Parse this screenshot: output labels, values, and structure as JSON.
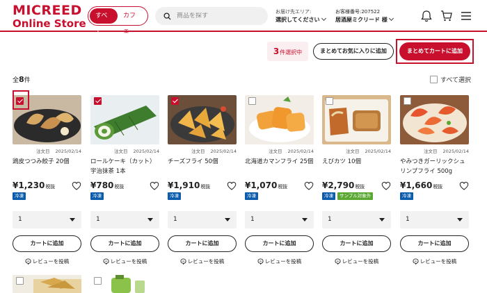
{
  "brand": {
    "line1": "MICREED",
    "line2": "Online Store",
    "color": "#c8102e"
  },
  "header": {
    "toggle": [
      "すべて",
      "カフェ"
    ],
    "search_placeholder": "商品を探す",
    "delivery_label": "お届け先エリア:",
    "delivery_value": "選択してください",
    "customer_label": "お客様番号:207522",
    "customer_value": "居酒屋ミクリード 様",
    "icons": [
      "bell-icon",
      "cart-icon",
      "menu-icon"
    ]
  },
  "actions": {
    "selected_count": "3",
    "selected_suffix": "件選択中",
    "favorite_label": "まとめてお気に入りに追加",
    "cart_label": "まとめてカートに追加"
  },
  "list": {
    "total_prefix": "全",
    "total_count": "8",
    "total_suffix": "件",
    "select_all": "すべて選択"
  },
  "products": [
    {
      "checked": true,
      "order_label": "注文日",
      "date": "2025/02/14",
      "name": "鶏皮つつみ餃子 20個",
      "price": "¥1,230",
      "tax": "税抜",
      "badges": [
        "冷凍"
      ],
      "qty": "1",
      "cart": "カートに追加",
      "review": "レビューを投稿"
    },
    {
      "checked": true,
      "order_label": "注文日",
      "date": "2025/02/14",
      "name": "ロールケーキ（カット）宇治抹茶 1本",
      "price": "¥780",
      "tax": "税抜",
      "badges": [
        "冷凍"
      ],
      "qty": "1",
      "cart": "カートに追加",
      "review": "レビューを投稿"
    },
    {
      "checked": true,
      "order_label": "注文日",
      "date": "2025/02/14",
      "name": "チーズフライ 50個",
      "price": "¥1,910",
      "tax": "税抜",
      "badges": [
        "冷凍"
      ],
      "qty": "1",
      "cart": "カートに追加",
      "review": "レビューを投稿"
    },
    {
      "checked": false,
      "order_label": "注文日",
      "date": "2025/02/14",
      "name": "北海道カマンフライ 25個",
      "price": "¥1,070",
      "tax": "税抜",
      "badges": [
        "冷凍"
      ],
      "qty": "1",
      "cart": "カートに追加",
      "review": "レビューを投稿"
    },
    {
      "checked": false,
      "order_label": "注文日",
      "date": "2025/02/14",
      "name": "えびカツ 10個",
      "price": "¥2,790",
      "tax": "税抜",
      "badges": [
        "冷凍",
        "サンプル対象外"
      ],
      "qty": "1",
      "cart": "カートに追加",
      "review": "レビューを投稿"
    },
    {
      "checked": false,
      "order_label": "注文日",
      "date": "2025/02/14",
      "name": "やみつきガーリックシュリンプフライ 500g",
      "price": "¥1,660",
      "tax": "税抜",
      "badges": [
        "冷凍"
      ],
      "qty": "1",
      "cart": "カートに追加",
      "review": "レビューを投稿"
    }
  ],
  "colors": {
    "accent": "#c8102e",
    "frozen": "#0b5cab",
    "sample": "#5aa832"
  }
}
